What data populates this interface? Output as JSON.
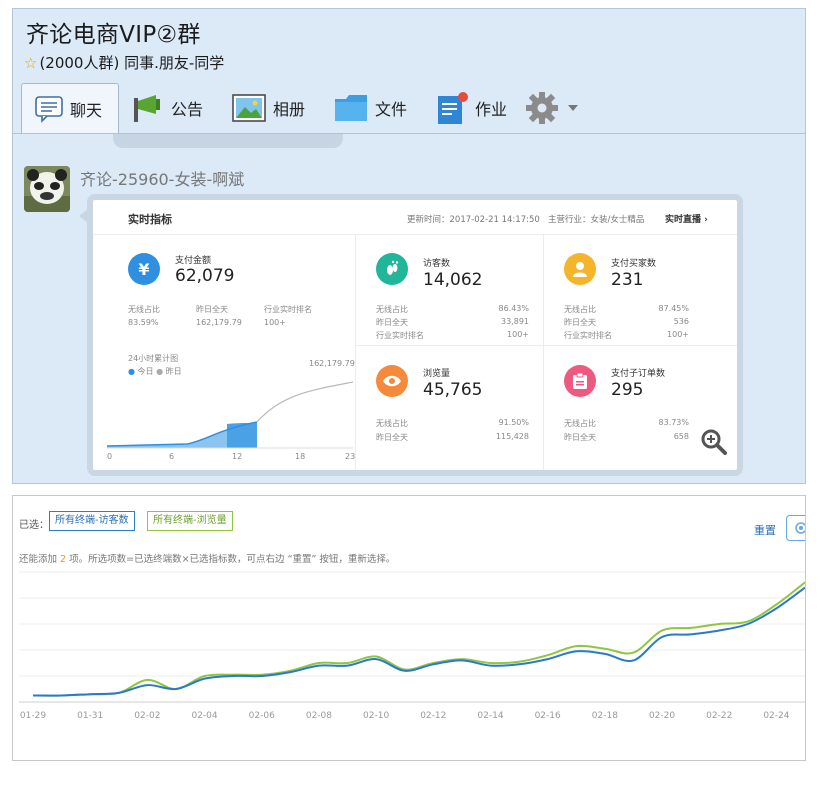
{
  "window": {
    "title": "齐论电商VIP②群",
    "member_count": "(2000人群)",
    "tags": "同事.朋友-同学"
  },
  "tabs": [
    {
      "label": "聊天",
      "icon": "chat-bubble-icon"
    },
    {
      "label": "公告",
      "icon": "megaphone-icon"
    },
    {
      "label": "相册",
      "icon": "photo-album-icon"
    },
    {
      "label": "文件",
      "icon": "folder-icon"
    },
    {
      "label": "作业",
      "icon": "homework-icon"
    },
    {
      "label": "",
      "icon": "gear-icon"
    }
  ],
  "message": {
    "sender": "齐论-25960-女装-啊斌"
  },
  "dashboard": {
    "title": "实时指标",
    "update_time": "更新时间：2017-02-21 14:17:50",
    "industry": "主营行业：女装/女士精品",
    "live_link": "实时直播",
    "metrics": [
      {
        "label": "支付金额",
        "value": "62,079",
        "icon_char": "¥",
        "color": "#2f8fe0",
        "stats": [
          {
            "name": "无线占比",
            "value": "83.59%"
          },
          {
            "name": "昨日全天",
            "value": "162,179.79"
          },
          {
            "name": "行业实时排名",
            "value": "100+"
          }
        ]
      },
      {
        "label": "访客数",
        "value": "14,062",
        "icon_char": "",
        "color": "#21b59a",
        "stats": [
          {
            "name": "无线占比",
            "value": "86.43%"
          },
          {
            "name": "昨日全天",
            "value": "33,891"
          },
          {
            "name": "行业实时排名",
            "value": "100+"
          }
        ]
      },
      {
        "label": "支付买家数",
        "value": "231",
        "icon_char": "",
        "color": "#f5b52b",
        "stats": [
          {
            "name": "无线占比",
            "value": "87.45%"
          },
          {
            "name": "昨日全天",
            "value": "536"
          },
          {
            "name": "行业实时排名",
            "value": "100+"
          }
        ]
      },
      {
        "label": "浏览量",
        "value": "45,765",
        "icon_char": "",
        "color": "#f58a3c",
        "stats": [
          {
            "name": "无线占比",
            "value": "91.50%"
          },
          {
            "name": "昨日全天",
            "value": "115,428"
          }
        ]
      },
      {
        "label": "支付子订单数",
        "value": "295",
        "icon_char": "",
        "color": "#ec5a80",
        "stats": [
          {
            "name": "无线占比",
            "value": "83.73%"
          },
          {
            "name": "昨日全天",
            "value": "658"
          }
        ]
      }
    ],
    "mini_chart": {
      "title": "24小时累计图",
      "legend": [
        "今日",
        "昨日"
      ],
      "peak_label": "162,179.79",
      "x_labels": [
        "0",
        "6",
        "12",
        "18",
        "23"
      ]
    }
  },
  "trend": {
    "selected_label": "已选：",
    "chips": [
      "所有终端-访客数",
      "所有终端-浏览量"
    ],
    "reset_label": "重置",
    "hint_before": "还能添加",
    "hint_count": "2",
    "hint_after": "项。所选项数=已选终端数×已选指标数，可点右边 “重置” 按钮，重新选择。"
  },
  "chart_data": {
    "type": "line",
    "x": [
      "01-29",
      "01-30",
      "01-31",
      "02-01",
      "02-02",
      "02-03",
      "02-04",
      "02-05",
      "02-06",
      "02-07",
      "02-08",
      "02-09",
      "02-10",
      "02-11",
      "02-12",
      "02-13",
      "02-14",
      "02-15",
      "02-16",
      "02-17",
      "02-18",
      "02-19",
      "02-20",
      "02-21",
      "02-22",
      "02-23",
      "02-24",
      "02-25"
    ],
    "x_tick_labels": [
      "01-29",
      "01-31",
      "02-02",
      "02-04",
      "02-06",
      "02-08",
      "02-10",
      "02-12",
      "02-14",
      "02-16",
      "02-18",
      "02-20",
      "02-22",
      "02-24"
    ],
    "series": [
      {
        "name": "所有终端-访客数",
        "color": "#2b78d0",
        "values": [
          5,
          5,
          6,
          7,
          13,
          10,
          18,
          20,
          20,
          23,
          28,
          28,
          33,
          24,
          29,
          32,
          28,
          29,
          33,
          39,
          37,
          32,
          50,
          52,
          55,
          60,
          72,
          88
        ]
      },
      {
        "name": "所有终端-浏览量",
        "color": "#8dc63f",
        "values": [
          5,
          5,
          6,
          7,
          17,
          10,
          20,
          21,
          21,
          24,
          30,
          30,
          35,
          25,
          30,
          33,
          30,
          31,
          36,
          43,
          41,
          38,
          55,
          57,
          60,
          62,
          75,
          92
        ]
      }
    ],
    "ylim": [
      0,
      100
    ],
    "grid": true
  }
}
